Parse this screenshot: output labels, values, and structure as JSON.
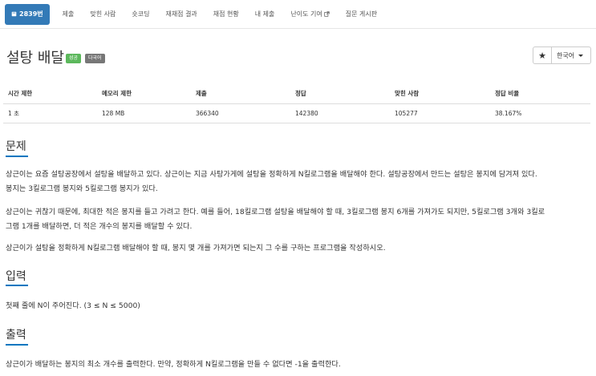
{
  "nav": {
    "problem_number": "2839번",
    "items": [
      "제출",
      "맞힌 사람",
      "숏코딩",
      "재채점 결과",
      "채점 현황",
      "내 제출",
      "난이도 기여",
      "질문 게시판"
    ]
  },
  "problem": {
    "title": "설탕 배달",
    "badge_success": "성공",
    "badge_multilang": "다국어",
    "star": "★",
    "language": "한국어"
  },
  "info": {
    "headers": [
      "시간 제한",
      "메모리 제한",
      "제출",
      "정답",
      "맞힌 사람",
      "정답 비율"
    ],
    "values": [
      "1 초",
      "128 MB",
      "366340",
      "142380",
      "105277",
      "38.167%"
    ]
  },
  "sections": {
    "problem_heading": "문제",
    "problem_p1_line1": "상근이는 요즘 설탕공장에서 설탕을 배달하고 있다. 상근이는 지금 사탕가게에 설탕을 정확하게 N킬로그램을 배달해야 한다. 설탕공장에서 만드는 설탕은 봉지에 담겨져 있다.",
    "problem_p1_line2": "봉지는 3킬로그램 봉지와 5킬로그램 봉지가 있다.",
    "problem_p2_line1": "상근이는 귀찮기 때문에, 최대한 적은 봉지를 들고 가려고 한다. 예를 들어, 18킬로그램 설탕을 배달해야 할 때, 3킬로그램 봉지 6개를 가져가도 되지만, 5킬로그램 3개와 3킬로",
    "problem_p2_line2": "그램 1개를 배달하면, 더 적은 개수의 봉지를 배달할 수 있다.",
    "problem_p3": "상근이가 설탕을 정확하게 N킬로그램 배달해야 할 때, 봉지 몇 개를 가져가면 되는지 그 수를 구하는 프로그램을 작성하시오.",
    "input_heading": "입력",
    "input_text": "첫째 줄에 N이 주어진다. (3 ≤ N ≤ 5000)",
    "output_heading": "출력",
    "output_text": "상근이가 배달하는 봉지의 최소 개수를 출력한다. 만약, 정확하게 N킬로그램을 만들 수 없다면 -1을 출력한다."
  }
}
